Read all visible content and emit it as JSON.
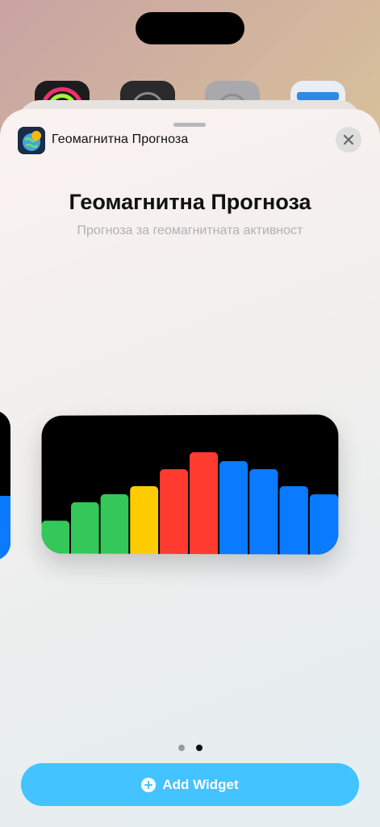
{
  "header": {
    "app_name": "Геомагнитна Прогноза"
  },
  "main": {
    "title": "Геомагнитна Прогноза",
    "subtitle": "Прогноза за геомагнитната активност"
  },
  "widget": {
    "bars": [
      {
        "value": 0.24,
        "color": "#34c759"
      },
      {
        "value": 0.37,
        "color": "#34c759"
      },
      {
        "value": 0.43,
        "color": "#34c759"
      },
      {
        "value": 0.49,
        "color": "#ffcc00"
      },
      {
        "value": 0.61,
        "color": "#ff3b30"
      },
      {
        "value": 0.73,
        "color": "#ff3b30"
      },
      {
        "value": 0.67,
        "color": "#0a7aff"
      },
      {
        "value": 0.61,
        "color": "#0a7aff"
      },
      {
        "value": 0.49,
        "color": "#0a7aff"
      },
      {
        "value": 0.43,
        "color": "#0a7aff"
      }
    ]
  },
  "pager": {
    "count": 2,
    "active_index": 1
  },
  "actions": {
    "add_widget_label": "Add Widget"
  },
  "icons": {
    "close": "close-icon",
    "add": "plus-circle-icon"
  }
}
